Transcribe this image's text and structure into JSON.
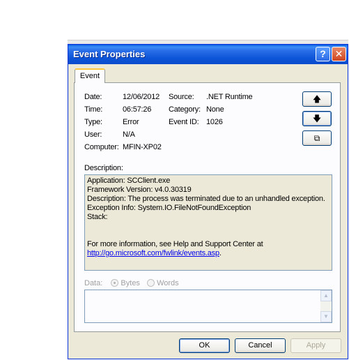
{
  "window": {
    "title": "Event Properties",
    "help_glyph": "?",
    "close_glyph": "✕"
  },
  "tab": {
    "label": "Event"
  },
  "fields": {
    "date_label": "Date:",
    "date_value": "12/06/2012",
    "source_label": "Source:",
    "source_value": ".NET Runtime",
    "time_label": "Time:",
    "time_value": "06:57:26",
    "category_label": "Category:",
    "category_value": "None",
    "type_label": "Type:",
    "type_value": "Error",
    "event_id_label": "Event ID:",
    "event_id_value": "1026",
    "user_label": "User:",
    "user_value": "N/A",
    "computer_label": "Computer:",
    "computer_value": "MFIN-XP02"
  },
  "side_buttons": {
    "up_glyph": "🡅",
    "down_glyph": "🡇",
    "copy_glyph": "⧉"
  },
  "description": {
    "label": "Description:",
    "lines": [
      "Application: SCClient.exe",
      "Framework Version: v4.0.30319",
      "Description: The process was terminated due to an unhandled exception.",
      "Exception Info: System.IO.FileNotFoundException",
      "Stack:"
    ],
    "more_info": "For more information, see Help and Support Center at",
    "link": "http://go.microsoft.com/fwlink/events.asp",
    "link_suffix": "."
  },
  "data": {
    "label": "Data:",
    "bytes_label": "Bytes",
    "words_label": "Words",
    "selected": "Bytes"
  },
  "buttons": {
    "ok": "OK",
    "cancel": "Cancel",
    "apply": "Apply"
  },
  "icons": [
    "help-icon",
    "close-icon",
    "up-arrow-icon",
    "down-arrow-icon",
    "copy-icon",
    "scroll-up-icon",
    "scroll-down-icon"
  ]
}
